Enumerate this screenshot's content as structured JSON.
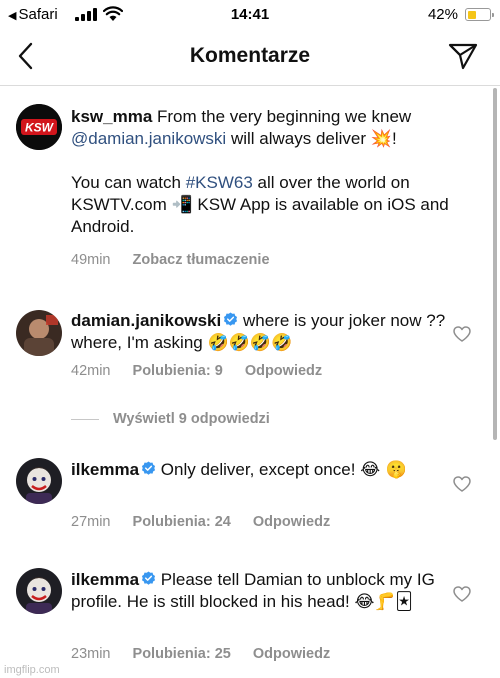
{
  "status_bar": {
    "back_label": "Safari",
    "time": "14:41",
    "battery_pct": "42%",
    "battery_level": 0.42
  },
  "nav": {
    "title": "Komentarze"
  },
  "caption": {
    "username": "ksw_mma",
    "text_1": "From the very beginning we knew",
    "mention": "@damian.janikowski",
    "text_2": "will always deliver",
    "emoji_1": "💥",
    "text_3": "!",
    "text_4": "You can watch",
    "hashtag": "#KSW63",
    "text_5": "all over the world on KSWTV.com",
    "emoji_2": "📲",
    "text_6": "KSW App is available on iOS and Android.",
    "time": "49min",
    "translate_label": "Zobacz tłumaczenie",
    "avatar_text": "KSW"
  },
  "comments": [
    {
      "username": "damian.janikowski",
      "text": "where is your joker now ?? where, I'm asking",
      "emoji": "🤣🤣🤣🤣",
      "time": "42min",
      "likes_label": "Polubienia: 9",
      "reply_label": "Odpowiedz"
    },
    {
      "username": "ilkemma",
      "text": "Only deliver, except once!",
      "emoji": "😂 🤫",
      "time": "27min",
      "likes_label": "Polubienia: 24",
      "reply_label": "Odpowiedz"
    },
    {
      "username": "ilkemma",
      "text": "Please tell Damian to unblock my IG profile. He is still blocked in his head!",
      "emoji": "😂🦵🃏",
      "time": "23min",
      "likes_label": "Polubienia: 25",
      "reply_label": "Odpowiedz"
    }
  ],
  "view_replies_label": "Wyświetl 9 odpowiedzi",
  "watermark": "imgflip.com",
  "colors": {
    "link": "#30507f",
    "meta": "#8e8e8e",
    "verified": "#3897f0",
    "battery": "#f5c518"
  }
}
